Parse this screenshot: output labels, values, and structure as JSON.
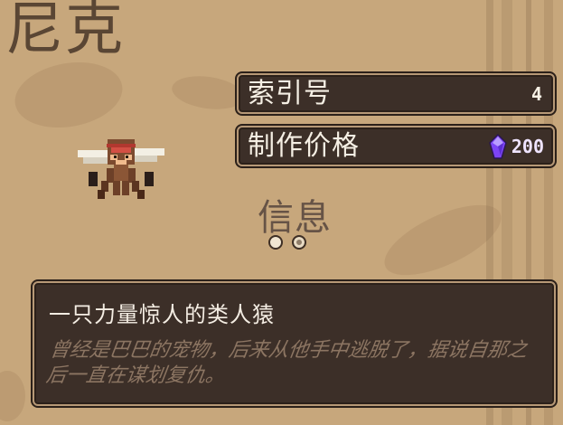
{
  "character": {
    "name": "尼克"
  },
  "stats": {
    "index_label": "索引号",
    "index_value": "4",
    "cost_label": "制作价格",
    "cost_value": "200"
  },
  "section": {
    "title": "信息",
    "dots": [
      "inactive",
      "active"
    ]
  },
  "description": {
    "title": "一只力量惊人的类人猿",
    "body": "曾经是巴巴的宠物，后来从他手中逃脱了，据说自那之后一直在谋划复仇。"
  },
  "icons": {
    "cost_icon": "purple-crystal-icon",
    "sprite": "winged-monkey-sprite"
  },
  "colors": {
    "background": "#c7a77c",
    "panel": "#3c2f28",
    "panel_border": "#b69876",
    "text_light": "#f5efe4",
    "text_muted": "#8c7562",
    "crystal": "#8e5cff"
  }
}
